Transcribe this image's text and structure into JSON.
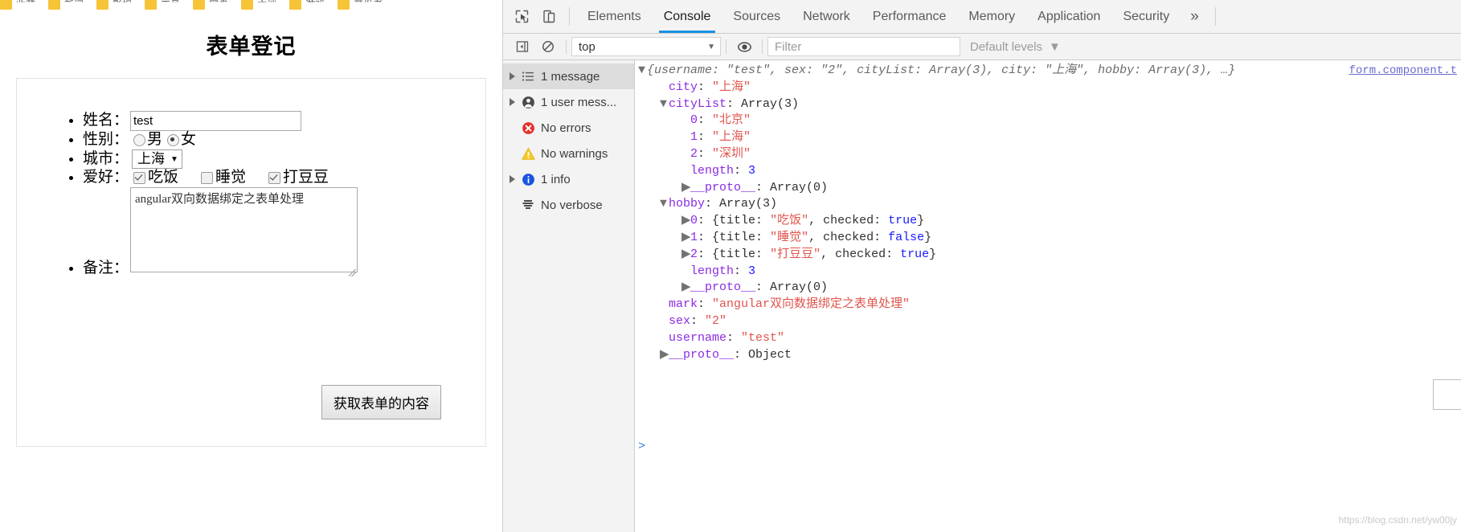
{
  "browser": {
    "bookmarks": [
      "收藏",
      "新闻",
      "影视",
      "工具",
      "网盘",
      "文档",
      "游戏",
      "开发者"
    ]
  },
  "page": {
    "title": "表单登记",
    "fields": {
      "name": {
        "label": "姓名：",
        "value": "test"
      },
      "sex": {
        "label": "性别：",
        "options": [
          {
            "label": "男",
            "checked": false
          },
          {
            "label": "女",
            "checked": true
          }
        ]
      },
      "city": {
        "label": "城市：",
        "value": "上海",
        "caret": "▼"
      },
      "hobby": {
        "label": "爱好：",
        "items": [
          {
            "label": "吃饭",
            "checked": true
          },
          {
            "label": "睡觉",
            "checked": false
          },
          {
            "label": "打豆豆",
            "checked": true
          }
        ]
      },
      "remark": {
        "label": "备注：",
        "value": "angular双向数据绑定之表单处理"
      }
    },
    "submit_label": "获取表单的内容"
  },
  "devtools": {
    "icons": {
      "inspect": "inspect-element-icon",
      "device": "device-toolbar-icon",
      "sidebar": "console-sidebar-icon",
      "clear": "clear-console-icon",
      "eye": "live-expression-icon"
    },
    "tabs": [
      {
        "label": "Elements",
        "active": false
      },
      {
        "label": "Console",
        "active": true
      },
      {
        "label": "Sources",
        "active": false
      },
      {
        "label": "Network",
        "active": false
      },
      {
        "label": "Performance",
        "active": false
      },
      {
        "label": "Memory",
        "active": false
      },
      {
        "label": "Application",
        "active": false
      },
      {
        "label": "Security",
        "active": false
      }
    ],
    "more_tabs": "»",
    "filterbar": {
      "context": "top",
      "context_caret": "▼",
      "filter_placeholder": "Filter",
      "filter_value": "",
      "levels": "Default levels",
      "levels_caret": "▼"
    },
    "sidebar": [
      {
        "label": "1 message",
        "icon": "list-icon",
        "expandable": true,
        "selected": true
      },
      {
        "label": "1 user mess...",
        "icon": "user-icon",
        "expandable": true,
        "selected": false
      },
      {
        "label": "No errors",
        "icon": "error-icon",
        "expandable": false,
        "selected": false
      },
      {
        "label": "No warnings",
        "icon": "warning-icon",
        "expandable": false,
        "selected": false
      },
      {
        "label": "1 info",
        "icon": "info-icon",
        "expandable": true,
        "selected": false
      },
      {
        "label": "No verbose",
        "icon": "verbose-icon",
        "expandable": false,
        "selected": false
      }
    ],
    "source_link": "form.component.t",
    "prompt_symbol": ">",
    "watermark": "https://blog.csdn.net/yw00jy",
    "console": {
      "summary_prefix": "{username: ",
      "summary": [
        "{username: ",
        "\"test\"",
        ", sex: ",
        "\"2\"",
        ", cityList: Array(3), city: ",
        "\"上海\"",
        ", hobby: Array(3), …}"
      ],
      "lines": [
        {
          "indent": 1,
          "toggle": "▼",
          "text": "{username: \"test\", sex: \"2\", cityList: Array(3), city: \"上海\", hobby: Array(3), …}",
          "kind": "preview"
        },
        {
          "indent": 2,
          "toggle": "",
          "key": "city",
          "sep": ": ",
          "value": "\"上海\"",
          "kind": "string"
        },
        {
          "indent": 2,
          "toggle": "▼",
          "key": "cityList",
          "sep": ": ",
          "value": "Array(3)",
          "kind": "plain"
        },
        {
          "indent": 3,
          "toggle": "",
          "key": "0",
          "sep": ": ",
          "value": "\"北京\"",
          "kind": "string"
        },
        {
          "indent": 3,
          "toggle": "",
          "key": "1",
          "sep": ": ",
          "value": "\"上海\"",
          "kind": "string"
        },
        {
          "indent": 3,
          "toggle": "",
          "key": "2",
          "sep": ": ",
          "value": "\"深圳\"",
          "kind": "string"
        },
        {
          "indent": 3,
          "toggle": "",
          "key": "length",
          "sep": ": ",
          "value": "3",
          "kind": "number"
        },
        {
          "indent": 3,
          "toggle": "▶",
          "key": "__proto__",
          "sep": ": ",
          "value": "Array(0)",
          "kind": "plain"
        },
        {
          "indent": 2,
          "toggle": "▼",
          "key": "hobby",
          "sep": ": ",
          "value": "Array(3)",
          "kind": "plain"
        },
        {
          "indent": 3,
          "toggle": "▶",
          "key": "0",
          "sep": ": ",
          "value": "{title: \"吃饭\", checked: true}",
          "kind": "object"
        },
        {
          "indent": 3,
          "toggle": "▶",
          "key": "1",
          "sep": ": ",
          "value": "{title: \"睡觉\", checked: false}",
          "kind": "object"
        },
        {
          "indent": 3,
          "toggle": "▶",
          "key": "2",
          "sep": ": ",
          "value": "{title: \"打豆豆\", checked: true}",
          "kind": "object"
        },
        {
          "indent": 3,
          "toggle": "",
          "key": "length",
          "sep": ": ",
          "value": "3",
          "kind": "number"
        },
        {
          "indent": 3,
          "toggle": "▶",
          "key": "__proto__",
          "sep": ": ",
          "value": "Array(0)",
          "kind": "plain"
        },
        {
          "indent": 2,
          "toggle": "",
          "key": "mark",
          "sep": ": ",
          "value": "\"angular双向数据绑定之表单处理\"",
          "kind": "string"
        },
        {
          "indent": 2,
          "toggle": "",
          "key": "sex",
          "sep": ": ",
          "value": "\"2\"",
          "kind": "string"
        },
        {
          "indent": 2,
          "toggle": "",
          "key": "username",
          "sep": ": ",
          "value": "\"test\"",
          "kind": "string"
        },
        {
          "indent": 2,
          "toggle": "▶",
          "key": "__proto__",
          "sep": ": ",
          "value": "Object",
          "kind": "plain"
        }
      ]
    }
  }
}
